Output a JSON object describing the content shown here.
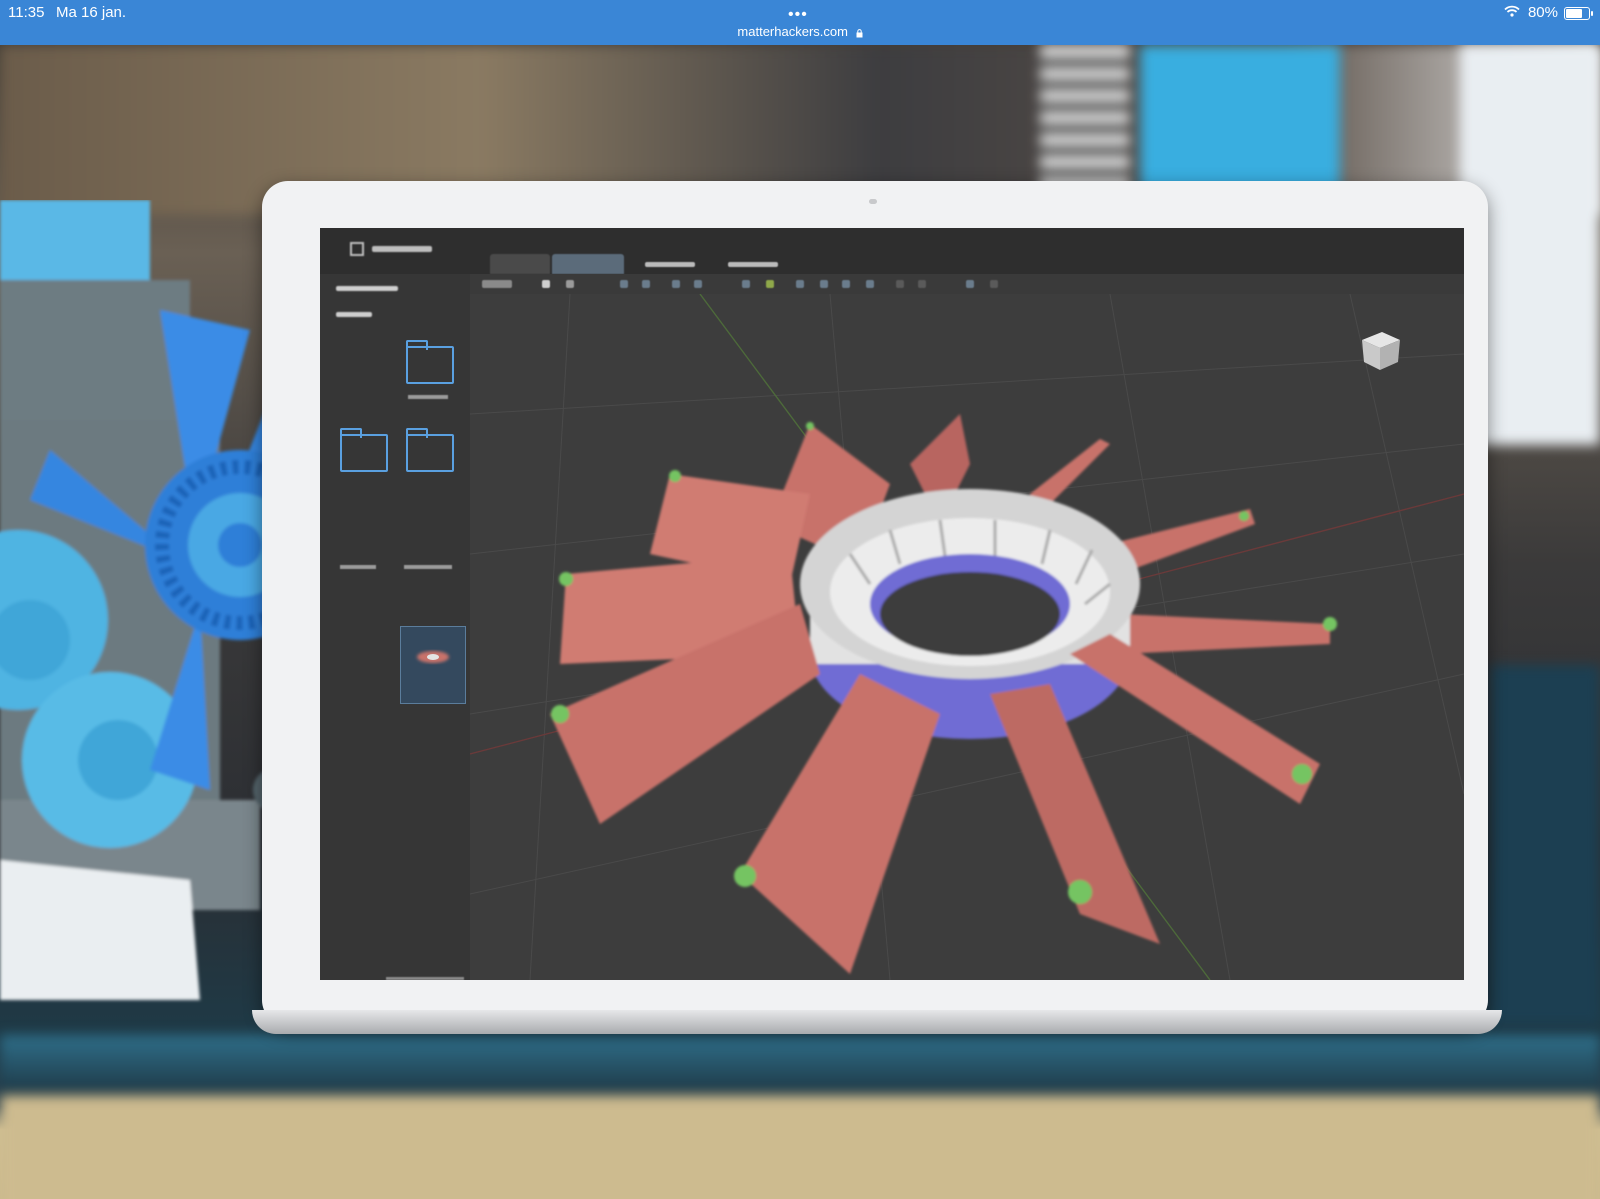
{
  "status_bar": {
    "time": "11:35",
    "date": "Ma 16 jan.",
    "url": "matterhackers.com",
    "lock_icon": "lock-icon",
    "menu_dots": "•••",
    "battery_percent": "80%",
    "wifi_icon": "wifi-icon",
    "battery_icon": "battery-icon"
  },
  "colors": {
    "status_bar_bg": "#3a86d6",
    "fan_blade": "#c8726a",
    "fan_hub": "#e4e4e4",
    "fan_ring": "#7b78d8",
    "blade_tip": "#74c462",
    "engine_blue": "#3b8ee6",
    "app_bg": "#3d3d3d"
  }
}
